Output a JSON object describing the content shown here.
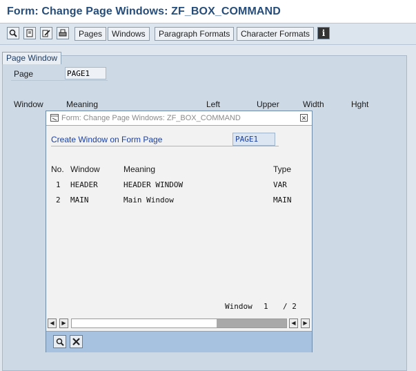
{
  "window": {
    "title": "Form: Change Page Windows: ZF_BOX_COMMAND"
  },
  "toolbar": {
    "icons": [
      "display-icon",
      "page-icon",
      "edit-icon",
      "print-icon"
    ],
    "buttons": [
      "Pages",
      "Windows",
      "Paragraph Formats",
      "Character Formats"
    ],
    "info_icon": "info-icon"
  },
  "page_window": {
    "tab_label": "Page Window",
    "page_label": "Page",
    "page_value": "PAGE1",
    "columns": [
      "Window",
      "Meaning",
      "Left",
      "Upper",
      "Width",
      "Hght"
    ]
  },
  "dialog": {
    "title": "Form: Change Page Windows: ZF_BOX_COMMAND",
    "create_label": "Create Window on Form Page",
    "create_value": "PAGE1",
    "columns": [
      "No.",
      "Window",
      "Meaning",
      "Type"
    ],
    "rows": [
      {
        "no": "1",
        "window": "HEADER",
        "meaning": "HEADER WINDOW",
        "type": "VAR"
      },
      {
        "no": "2",
        "window": "MAIN",
        "meaning": "Main Window",
        "type": "MAIN"
      }
    ],
    "pager": {
      "label": "Window",
      "current": "1",
      "total": "/ 2"
    }
  },
  "colors": {
    "title": "#264d7a",
    "link_blue": "#1a3fa0",
    "footer": "#a7c2e1"
  }
}
